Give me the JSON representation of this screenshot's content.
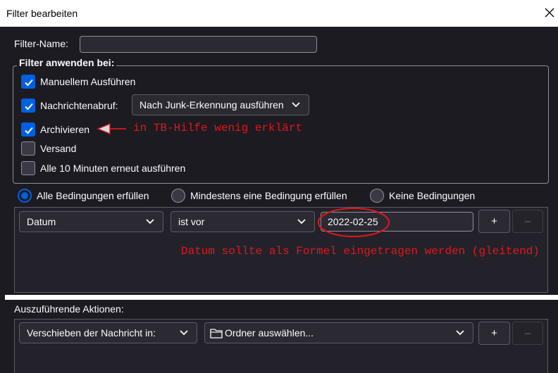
{
  "window": {
    "title": "Filter bearbeiten"
  },
  "filter_name": {
    "label": "Filter-Name:",
    "value": ""
  },
  "apply_on": {
    "legend": "Filter anwenden bei:",
    "options": [
      {
        "label": "Manuellem Ausführen",
        "checked": true
      },
      {
        "label": "Nachrichtenabruf:",
        "checked": true
      },
      {
        "label": "Archivieren",
        "checked": true
      },
      {
        "label": "Versand",
        "checked": false
      },
      {
        "label": "Alle 10 Minuten erneut ausführen",
        "checked": false
      }
    ],
    "fetch_mode": "Nach Junk-Erkennung ausführen"
  },
  "match_mode": {
    "options": [
      "Alle Bedingungen erfüllen",
      "Mindestens eine Bedingung erfüllen",
      "Keine Bedingungen"
    ],
    "selected": "Alle Bedingungen erfüllen"
  },
  "condition": {
    "field": "Datum",
    "operator": "ist vor",
    "value": "2022-02-25",
    "add_label": "+",
    "remove_label": "–"
  },
  "actions": {
    "label": "Auszuführende Aktionen:",
    "action": "Verschieben der Nachricht in:",
    "target": "Ordner auswählen...",
    "add_label": "+",
    "remove_label": "–"
  },
  "annotations": {
    "archive_note": "in TB-Hilfe wenig erklärt",
    "date_note": "Datum sollte als Formel eingetragen werden (gleitend)"
  },
  "colors": {
    "accent": "#0060df",
    "annotation": "#e01818",
    "background": "#1c1b22"
  },
  "icons": [
    "close-icon",
    "checkmark-icon",
    "chevron-down-icon",
    "folder-icon",
    "arrow-left-icon"
  ]
}
